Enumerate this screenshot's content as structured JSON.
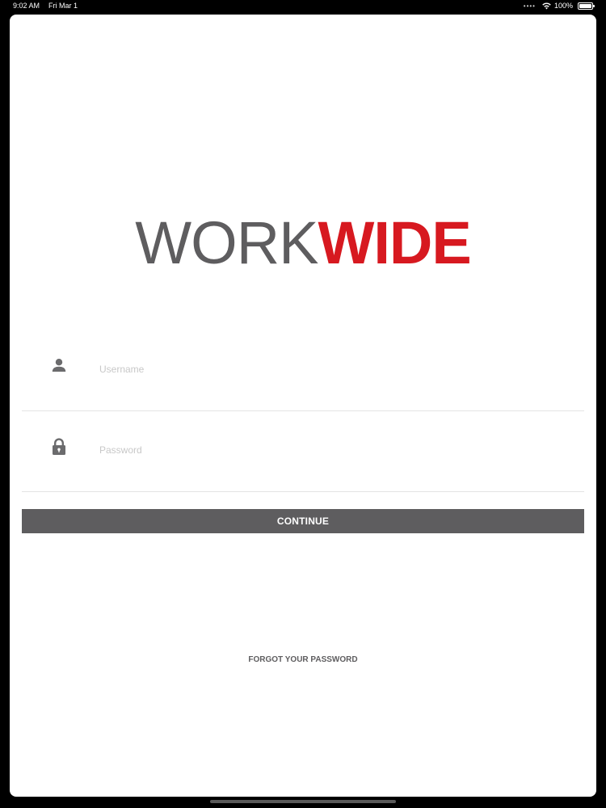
{
  "status_bar": {
    "time": "9:02 AM",
    "date": "Fri Mar 1",
    "battery": "100%",
    "icons": [
      "wifi-icon",
      "battery-icon"
    ]
  },
  "logo": {
    "part1": "WORK",
    "part2": "WIDE",
    "colors": {
      "part1": "#5e5d5f",
      "part2": "#d71920"
    }
  },
  "form": {
    "username": {
      "placeholder": "Username",
      "value": "",
      "icon": "user-icon"
    },
    "password": {
      "placeholder": "Password",
      "value": "",
      "icon": "lock-icon"
    }
  },
  "continue_label": "CONTINUE",
  "forgot_label": "FORGOT YOUR PASSWORD",
  "colors": {
    "accent": "#d71920",
    "button": "#5e5d5f",
    "background": "#ffffff"
  }
}
